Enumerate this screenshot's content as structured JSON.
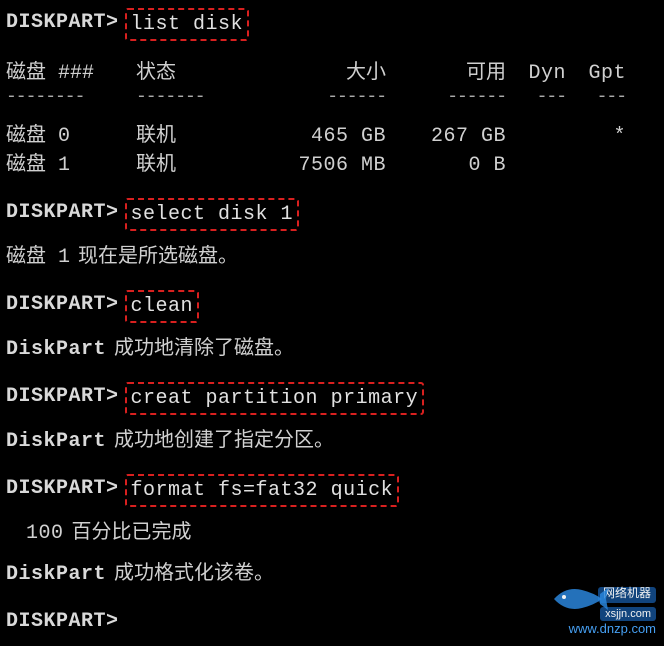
{
  "prompt": "DISKPART>",
  "commands": {
    "list_disk": "list disk",
    "select_disk": "select disk 1",
    "clean": "clean",
    "create_partition": "creat partition primary",
    "format": "format fs=fat32 quick"
  },
  "table": {
    "headers": {
      "disk": "磁盘 ###",
      "status": "状态",
      "size": "大小",
      "free": "可用",
      "dyn": "Dyn",
      "gpt": "Gpt"
    },
    "underline": "---",
    "rows": [
      {
        "disk": "磁盘 0",
        "status": "联机",
        "size": "465 GB",
        "free": "267 GB",
        "dyn": "",
        "gpt": "*"
      },
      {
        "disk": "磁盘 1",
        "status": "联机",
        "size": "7506 MB",
        "free": "0 B",
        "dyn": "",
        "gpt": ""
      }
    ]
  },
  "messages": {
    "selected": {
      "prefix": "磁盘 1",
      "text": "现在是所选磁盘。"
    },
    "cleaned": {
      "prefix": "DiskPart",
      "text": "成功地清除了磁盘。"
    },
    "created": {
      "prefix": "DiskPart",
      "text": "成功地创建了指定分区。"
    },
    "progress": {
      "percent": "100",
      "text": "百分比已完成"
    },
    "formatted": {
      "prefix": "DiskPart",
      "text": "成功格式化该卷。"
    }
  },
  "watermark": {
    "line1": "网络机器",
    "line2": "xsjjn.com",
    "line3": "www.dnzp.com"
  }
}
